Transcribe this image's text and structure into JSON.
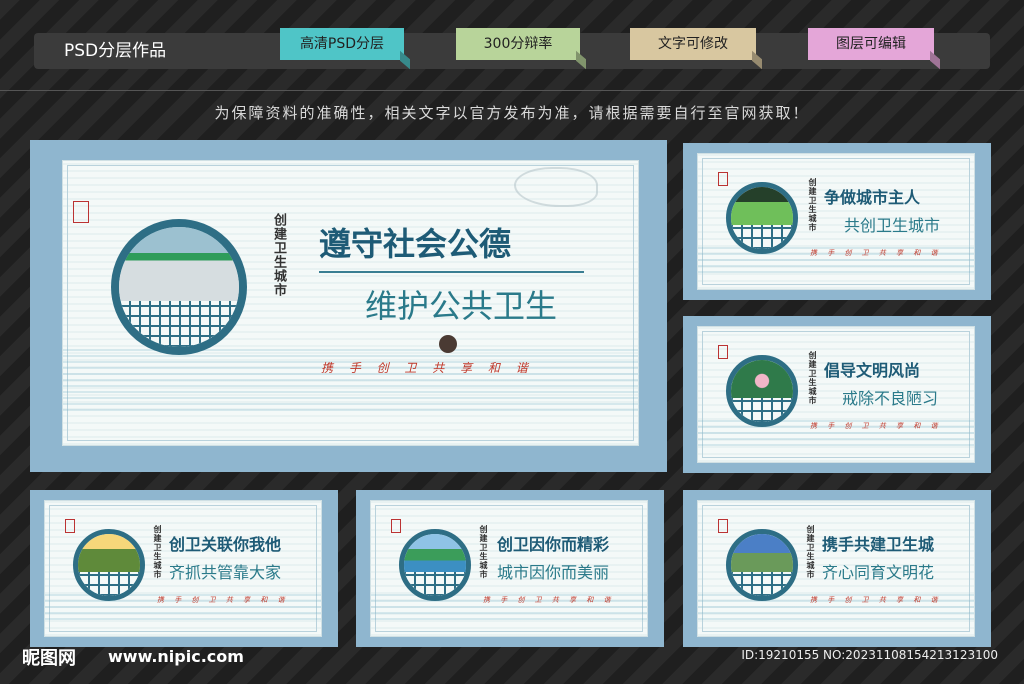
{
  "header": {
    "brand": "PSD分层作品",
    "tags": [
      "高清PSD分层",
      "300分辩率",
      "文字可修改",
      "图层可编辑"
    ]
  },
  "notice": "为保障资料的准确性，相关文字以官方发布为准，请根据需要自行至官网获取！",
  "boards": [
    {
      "title1": "遵守社会公德",
      "title2": "维护公共卫生",
      "slogan": "携 手 创 卫  共 享 和 谐",
      "vertical": "创建卫生城市"
    },
    {
      "title1": "争做城市主人",
      "title2": "共创卫生城市",
      "slogan": "携 手 创 卫  共 享 和 谐",
      "vertical": "创建卫生城市"
    },
    {
      "title1": "倡导文明风尚",
      "title2": "戒除不良陋习",
      "slogan": "携 手 创 卫  共 享 和 谐",
      "vertical": "创建卫生城市"
    },
    {
      "title1": "创卫关联你我他",
      "title2": "齐抓共管靠大家",
      "slogan": "携 手 创 卫  共 享 和 谐",
      "vertical": "创建卫生城市"
    },
    {
      "title1": "创卫因你而精彩",
      "title2": "城市因你而美丽",
      "slogan": "携 手 创 卫  共 享 和 谐",
      "vertical": "创建卫生城市"
    },
    {
      "title1": "携手共建卫生城",
      "title2": "齐心同育文明花",
      "slogan": "携 手 创 卫  共 享 和 谐",
      "vertical": "创建卫生城市"
    }
  ],
  "watermark": {
    "logo": "昵图网",
    "url": "www.nipic.com",
    "id": "ID:19210155 NO:20231108154213123100"
  }
}
